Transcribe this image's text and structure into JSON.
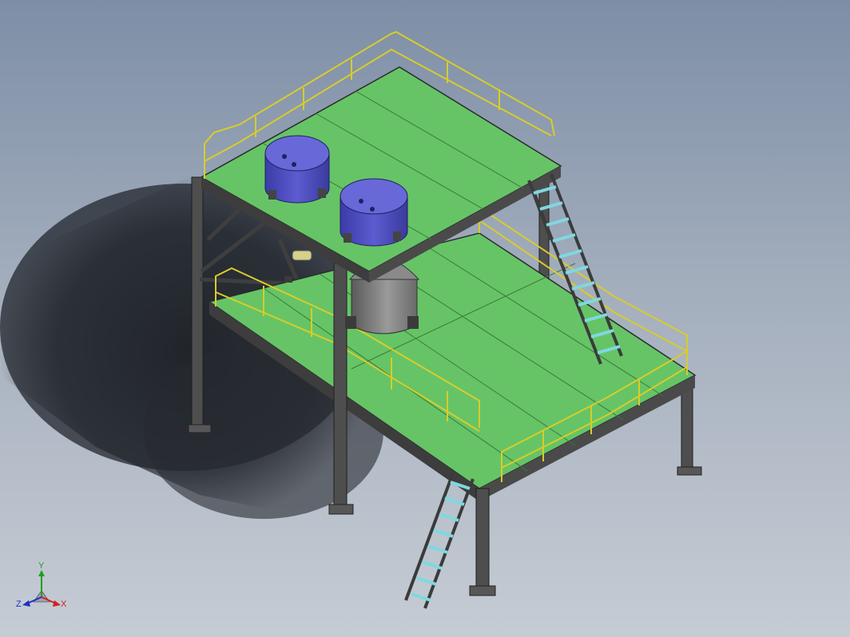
{
  "triad": {
    "x_label": "X",
    "y_label": "Y",
    "z_label": "Z",
    "x_color": "#d22020",
    "y_color": "#20a020",
    "z_color": "#2030c0"
  },
  "colors": {
    "background_top": "#7d8ea6",
    "background_bottom": "#c6ccd4",
    "deck": "#66c466",
    "steel": "#5c5c5c",
    "railing": "#d8cc2a",
    "tank": "#5656c8",
    "hopper": "#7a7a7a",
    "ladder_rung": "#7fd8e0"
  }
}
